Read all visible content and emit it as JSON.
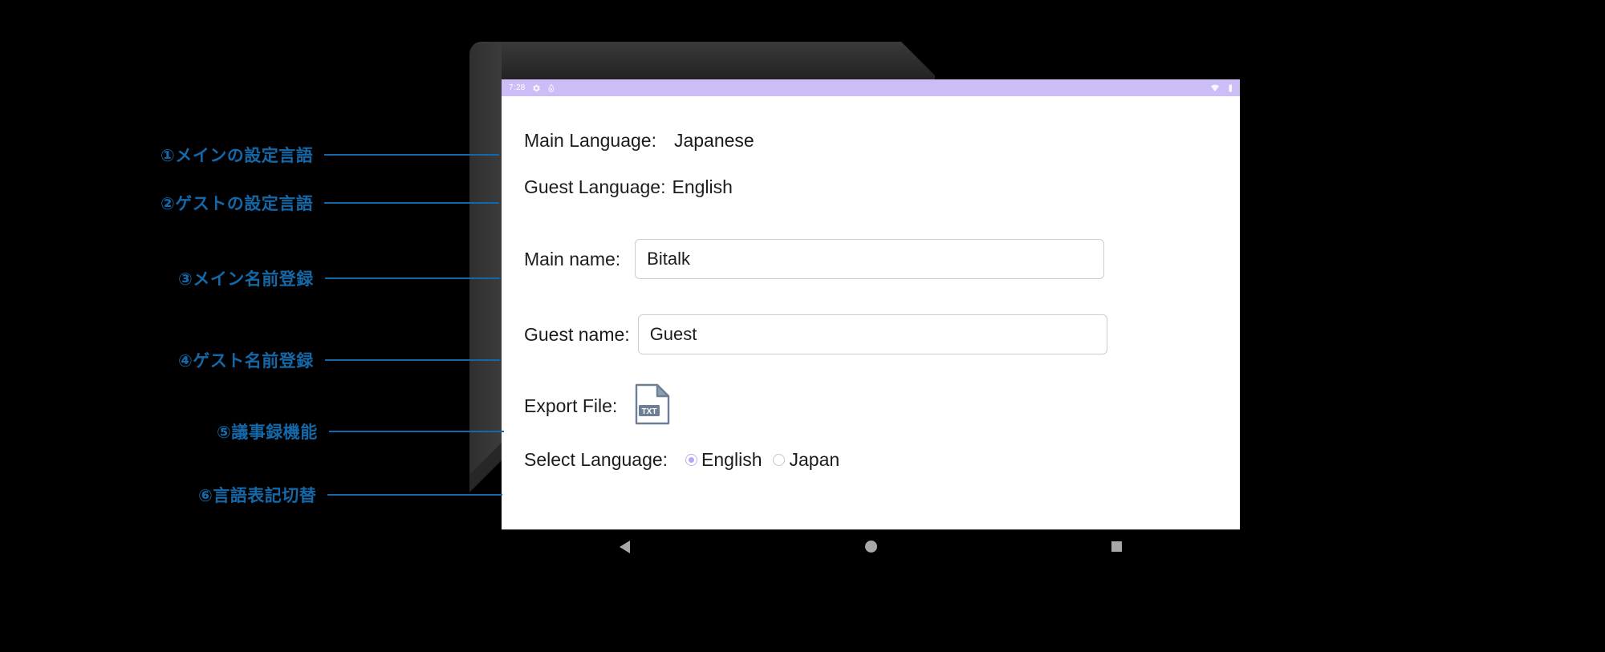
{
  "annotations": [
    {
      "id": "main-language",
      "label": "①メインの設定言語"
    },
    {
      "id": "guest-language",
      "label": "②ゲストの設定言語"
    },
    {
      "id": "main-name",
      "label": "③メイン名前登録"
    },
    {
      "id": "guest-name",
      "label": "④ゲスト名前登録"
    },
    {
      "id": "export-file",
      "label": "⑤議事録機能"
    },
    {
      "id": "select-language",
      "label": "⑥言語表記切替"
    }
  ],
  "annotation_color": "#1568a8",
  "status_bar": {
    "clock": "7:28",
    "icons": [
      "gear-icon",
      "lock-icon"
    ],
    "right_icons": [
      "wifi-icon",
      "battery-icon"
    ],
    "background": "#cdbdf7"
  },
  "app": {
    "main_language": {
      "label": "Main Language:",
      "value": "Japanese"
    },
    "guest_language": {
      "label": "Guest Language:",
      "value": "English"
    },
    "main_name": {
      "label": "Main name:",
      "value": "Bitalk",
      "placeholder": "Main name"
    },
    "guest_name": {
      "label": "Guest name:",
      "value": "Guest",
      "placeholder": "Guest name"
    },
    "export_file": {
      "label": "Export File:",
      "icon": "txt-file-icon",
      "icon_text": "TXT"
    },
    "select_language": {
      "label": "Select Language:",
      "options": [
        {
          "label": "English",
          "selected": true
        },
        {
          "label": "Japan",
          "selected": false
        }
      ],
      "selected_color": "#b9a6ee"
    }
  },
  "nav_bar": {
    "buttons": [
      "back-button",
      "home-button",
      "recents-button"
    ]
  }
}
